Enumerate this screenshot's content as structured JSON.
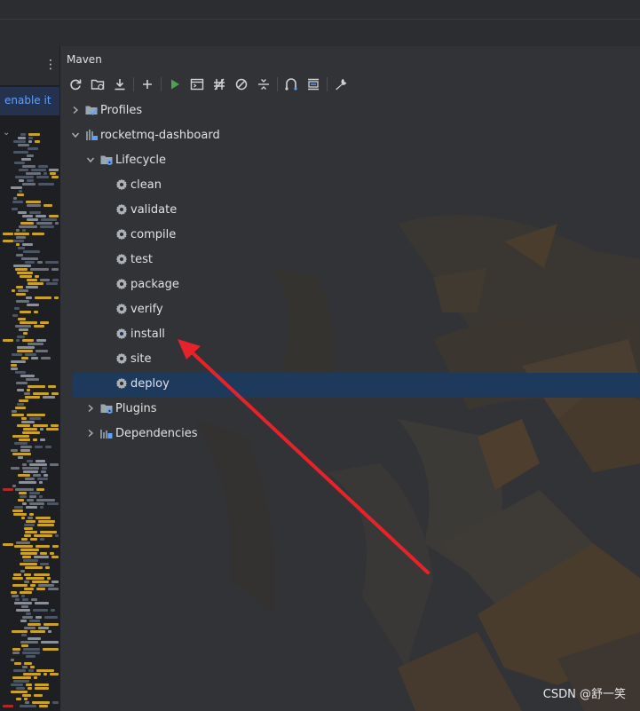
{
  "panel": {
    "title": "Maven"
  },
  "banner": {
    "link": "enable it"
  },
  "toolbar": {
    "icons": [
      "reload-icon",
      "add-folder-icon",
      "download-icon",
      "plus-icon",
      "run-icon",
      "terminal-icon",
      "toggle-offline-icon",
      "skip-tests-icon",
      "collapse-icon",
      "analyze-dependencies-icon",
      "show-diagram-icon",
      "settings-wrench-icon"
    ]
  },
  "tree": {
    "profiles": "Profiles",
    "project": "rocketmq-dashboard",
    "lifecycle": "Lifecycle",
    "goals": [
      "clean",
      "validate",
      "compile",
      "test",
      "package",
      "verify",
      "install",
      "site",
      "deploy"
    ],
    "selected_goal": "install",
    "plugins": "Plugins",
    "dependencies": "Dependencies"
  },
  "colors": {
    "selection": "#1d3a5c",
    "annotation_arrow": "#e8222a",
    "link": "#5ea1ff"
  },
  "watermark": "CSDN @舒一笑"
}
